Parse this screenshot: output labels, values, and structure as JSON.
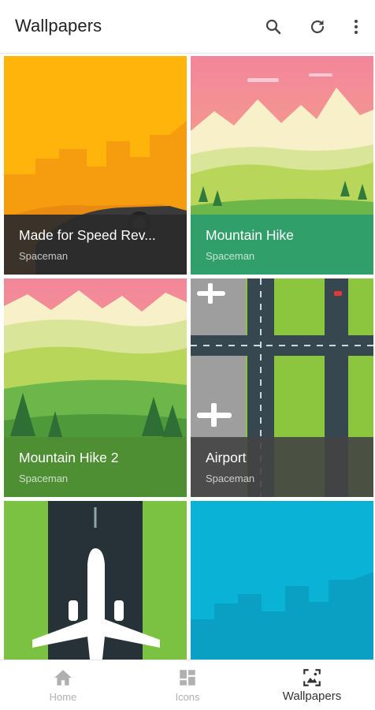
{
  "app_bar": {
    "title": "Wallpapers",
    "actions": [
      {
        "icon": "search-icon"
      },
      {
        "icon": "refresh-icon"
      },
      {
        "icon": "more-vert-icon"
      }
    ]
  },
  "wallpapers": [
    {
      "name": "Made for Speed Rev...",
      "author": "Spaceman",
      "caption_color": "#2b2b2b"
    },
    {
      "name": "Mountain Hike",
      "author": "Spaceman",
      "caption_color": "#2e9e6a"
    },
    {
      "name": "Mountain Hike 2",
      "author": "Spaceman",
      "caption_color": "#4e8e34"
    },
    {
      "name": "Airport",
      "author": "Spaceman",
      "caption_color": "#424242"
    },
    {
      "name": "",
      "author": ""
    },
    {
      "name": "",
      "author": ""
    }
  ],
  "bottom_nav": {
    "items": [
      {
        "label": "Home",
        "icon": "home-icon",
        "active": false
      },
      {
        "label": "Icons",
        "icon": "grid-icon",
        "active": false
      },
      {
        "label": "Wallpapers",
        "icon": "wallpaper-icon",
        "active": true
      }
    ]
  },
  "colors": {
    "accent": "#333333",
    "inactive": "#b0b0b0"
  }
}
